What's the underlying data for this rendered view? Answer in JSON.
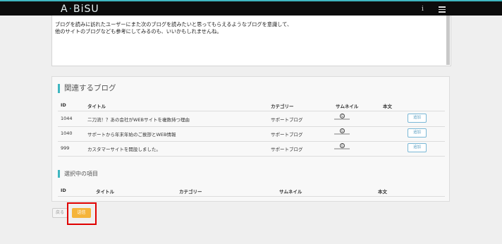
{
  "header": {
    "logo_left": "A",
    "logo_dot": "·",
    "logo_right": "BiSU",
    "info_icon": "info-icon",
    "menu_icon": "hamburger-menu-icon"
  },
  "memo_text": "ブログを読みに訪れたユーザーにまた次のブログを読みたいと思ってもらえるようなブログを意識して、\n他のサイトのブログなども参考にしてみるのも、いいかもしれませんね。",
  "related": {
    "title": "関連するブログ",
    "headers": {
      "id": "ID",
      "title": "タイトル",
      "category": "カテゴリー",
      "thumbnail": "サムネイル",
      "body": "本文"
    },
    "rows": [
      {
        "id": "1044",
        "title": "二刀流！？あの会社がWEBサイトを複数持つ理由",
        "category": "サポートブログ",
        "add": "追加"
      },
      {
        "id": "1040",
        "title": "サポートから年末年始のご挨拶とWEB情報",
        "category": "サポートブログ",
        "add": "追加"
      },
      {
        "id": "999",
        "title": "カスタマーサイトを開設しました。",
        "category": "サポートブログ",
        "add": "追加"
      }
    ]
  },
  "selected": {
    "title": "選択中の項目",
    "headers": {
      "id": "ID",
      "title": "タイトル",
      "category": "カテゴリー",
      "thumbnail": "サムネイル",
      "body": "本文"
    }
  },
  "buttons": {
    "back": "戻る",
    "send": "送信"
  },
  "colors": {
    "accent": "#3fb6c0",
    "send": "#f5b43a",
    "highlight": "#e00000"
  }
}
